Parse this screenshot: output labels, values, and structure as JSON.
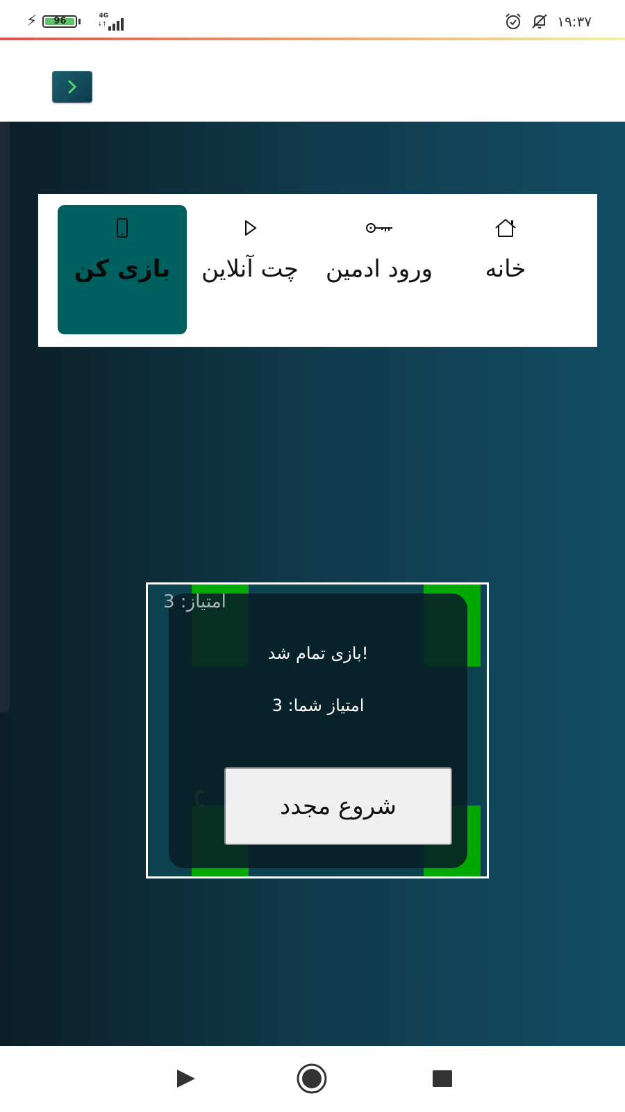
{
  "status_bar": {
    "battery_level": "96",
    "network_type": "4G",
    "network_arrows": "↓↑",
    "time": "۱۹:۳۷",
    "icons": [
      "charging-icon",
      "battery-icon",
      "signal-icon",
      "alarm-icon",
      "notifications-off-icon"
    ]
  },
  "header": {
    "menu_toggle_icon": "chevron-right-icon",
    "accent_color": "#4cd964"
  },
  "nav": {
    "items": [
      {
        "label": "بازی کن",
        "icon": "phone-icon",
        "active": true
      },
      {
        "label": "چت آنلاین",
        "icon": "play-icon",
        "active": false
      },
      {
        "label": "ورود ادمین",
        "icon": "key-icon",
        "active": false
      },
      {
        "label": "خانه",
        "icon": "home-icon",
        "active": false
      }
    ],
    "active_color": "#006060"
  },
  "game": {
    "score_label": "امتیاز: 3",
    "game_over_text": "!بازی تمام شد",
    "final_score_text": "امتیاز شما: 3",
    "restart_label": "شروع مجدد",
    "snake_color": "#00a800"
  },
  "system_nav": {
    "icons": [
      "back-icon",
      "home-circle-icon",
      "recents-icon"
    ]
  }
}
